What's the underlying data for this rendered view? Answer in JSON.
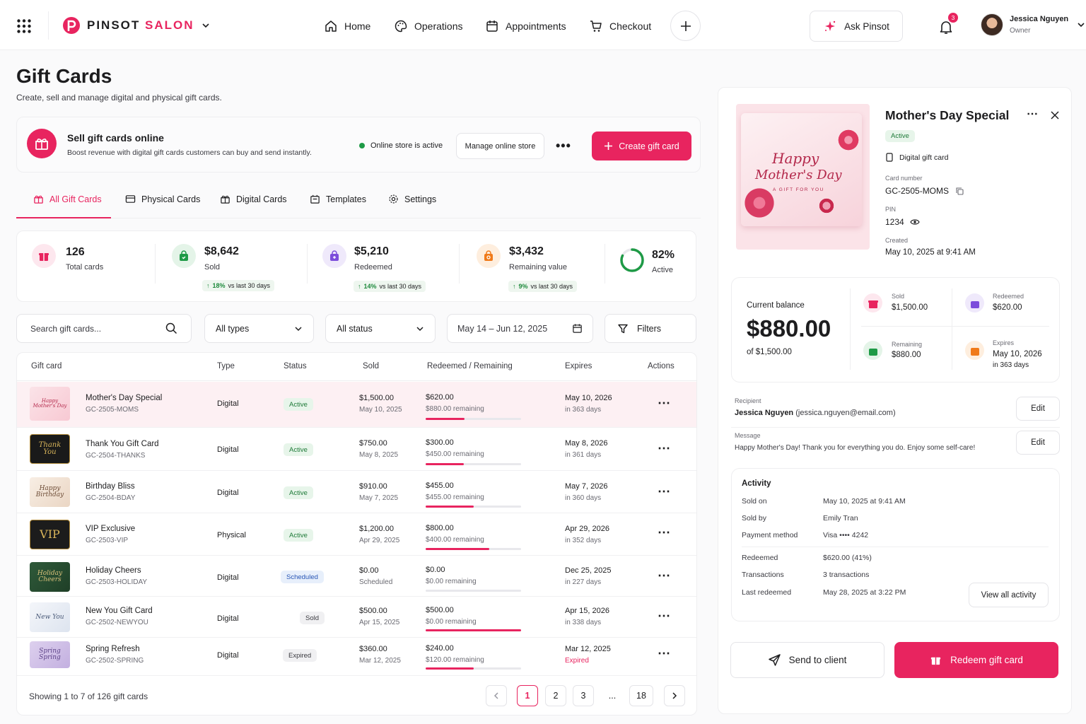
{
  "brand": {
    "name_part1": "PINSOT",
    "name_part2": "SALON",
    "accent": "#e8245f"
  },
  "nav": [
    {
      "label": "Home",
      "icon": "home-icon"
    },
    {
      "label": "Operations",
      "icon": "palette-icon"
    },
    {
      "label": "Appointments",
      "icon": "calendar-icon"
    },
    {
      "label": "Checkout",
      "icon": "cart-icon"
    }
  ],
  "ask": {
    "label": "Ask Pinsot"
  },
  "notifications": {
    "count": "3"
  },
  "user": {
    "name": "Jessica Nguyen",
    "role": "Owner"
  },
  "page": {
    "title": "Gift Cards",
    "subtitle": "Create, sell and manage digital and physical gift cards."
  },
  "banner": {
    "title": "Sell gift cards online",
    "desc": "Boost revenue with digital gift cards customers can buy and send instantly.",
    "status": "Online store is active",
    "manage": "Manage online store",
    "create": "Create gift card"
  },
  "tabs": [
    "All Gift Cards",
    "Physical Cards",
    "Digital Cards",
    "Templates",
    "Settings"
  ],
  "stats": {
    "total": {
      "value": "126",
      "label": "Total cards"
    },
    "sold": {
      "value": "$8,642",
      "label": "Sold",
      "trend": "18%",
      "note": "vs last 30 days"
    },
    "redeemed": {
      "value": "$5,210",
      "label": "Redeemed",
      "trend": "14%",
      "note": "vs last 30 days"
    },
    "remaining": {
      "value": "$3,432",
      "label": "Remaining value",
      "trend": "9%",
      "note": "vs last 30 days"
    },
    "active": {
      "value": "82%",
      "label": "Active",
      "fraction": 0.82
    }
  },
  "filters": {
    "search_placeholder": "Search gift cards...",
    "types": "All types",
    "status": "All status",
    "date": "May 14 – Jun 12, 2025",
    "filters": "Filters"
  },
  "table": {
    "headers": [
      "Gift card",
      "Type",
      "Status",
      "Sold",
      "Redeemed / Remaining",
      "Expires",
      "Actions"
    ],
    "rows": [
      {
        "thumb": "Happy Mother's Day",
        "name": "Mother's Day Special",
        "code": "GC-2505-MOMS",
        "type": "Digital",
        "status": "Active",
        "sold": "$1,500.00",
        "sold_date": "May 10, 2025",
        "redeemed": "$620.00",
        "remaining": "$880.00 remaining",
        "progress": 0.41,
        "expires": "May 10, 2026",
        "expires_note": "in 363 days"
      },
      {
        "thumb": "Thank You",
        "name": "Thank You Gift Card",
        "code": "GC-2504-THANKS",
        "type": "Digital",
        "status": "Active",
        "sold": "$750.00",
        "sold_date": "May 8, 2025",
        "redeemed": "$300.00",
        "remaining": "$450.00 remaining",
        "progress": 0.4,
        "expires": "May 8, 2026",
        "expires_note": "in 361 days"
      },
      {
        "thumb": "Happy Birthday",
        "name": "Birthday Bliss",
        "code": "GC-2504-BDAY",
        "type": "Digital",
        "status": "Active",
        "sold": "$910.00",
        "sold_date": "May 7, 2025",
        "redeemed": "$455.00",
        "remaining": "$455.00 remaining",
        "progress": 0.5,
        "expires": "May 7, 2026",
        "expires_note": "in 360 days"
      },
      {
        "thumb": "VIP",
        "name": "VIP Exclusive",
        "code": "GC-2503-VIP",
        "type": "Physical",
        "status": "Active",
        "sold": "$1,200.00",
        "sold_date": "Apr 29, 2025",
        "redeemed": "$800.00",
        "remaining": "$400.00 remaining",
        "progress": 0.67,
        "expires": "Apr 29, 2026",
        "expires_note": "in 352 days"
      },
      {
        "thumb": "Holiday Cheers",
        "name": "Holiday Cheers",
        "code": "GC-2503-HOLIDAY",
        "type": "Digital",
        "status": "Scheduled",
        "sold": "$0.00",
        "sold_date": "Scheduled",
        "redeemed": "$0.00",
        "remaining": "$0.00 remaining",
        "progress": 0,
        "expires": "Dec 25, 2025",
        "expires_note": "in 227 days"
      },
      {
        "thumb": "New You",
        "name": "New You Gift Card",
        "code": "GC-2502-NEWYOU",
        "type": "Digital",
        "status": "Sold",
        "sold": "$500.00",
        "sold_date": "Apr 15, 2025",
        "redeemed": "$500.00",
        "remaining": "$0.00 remaining",
        "progress": 1,
        "expires": "Apr 15, 2026",
        "expires_note": "in 338 days"
      },
      {
        "thumb": "Spring Spring",
        "name": "Spring Refresh",
        "code": "GC-2502-SPRING",
        "type": "Digital",
        "status": "Expired",
        "sold": "$360.00",
        "sold_date": "Mar 12, 2025",
        "redeemed": "$240.00",
        "remaining": "$120.00 remaining",
        "progress": 0.5,
        "expires": "Mar 12, 2025",
        "expires_note": "Expired"
      }
    ]
  },
  "pagination": {
    "showing": "Showing 1 to 7 of 126 gift cards",
    "pages": [
      "1",
      "2",
      "3",
      "...",
      "18"
    ]
  },
  "detail": {
    "card_text1": "Happy",
    "card_text2": "Mother's Day",
    "card_text3": "A GIFT FOR YOU",
    "title": "Mother's Day Special",
    "status": "Active",
    "type": "Digital gift card",
    "card_number_label": "Card number",
    "card_number": "GC-2505-MOMS",
    "pin_label": "PIN",
    "pin": "1234",
    "created_label": "Created",
    "created": "May 10, 2025 at 9:41 AM",
    "balance_label": "Current balance",
    "balance": "$880.00",
    "balance_of": "of $1,500.00",
    "sold_label": "Sold",
    "sold": "$1,500.00",
    "redeemed_label": "Redeemed",
    "redeemed": "$620.00",
    "remaining_label": "Remaining",
    "remaining": "$880.00",
    "expires_label": "Expires",
    "expires": "May 10, 2026",
    "expires_note": "in 363 days",
    "recipient_label": "Recipient",
    "recipient_name": "Jessica Nguyen",
    "recipient_email": "(jessica.nguyen@email.com)",
    "message_label": "Message",
    "message": "Happy Mother's Day! Thank you for everything you do. Enjoy some self-care!",
    "edit": "Edit",
    "activity_title": "Activity",
    "activity": [
      {
        "label": "Sold on",
        "value": "May 10, 2025 at 9:41 AM"
      },
      {
        "label": "Sold by",
        "value": "Emily Tran"
      },
      {
        "label": "Payment method",
        "value": "Visa •••• 4242"
      },
      {
        "label": "Redeemed",
        "value": "$620.00 (41%)"
      },
      {
        "label": "Transactions",
        "value": "3 transactions"
      },
      {
        "label": "Last redeemed",
        "value": "May 28, 2025 at 3:22 PM"
      }
    ],
    "view_all": "View all activity",
    "send": "Send to client",
    "redeem": "Redeem gift card"
  }
}
